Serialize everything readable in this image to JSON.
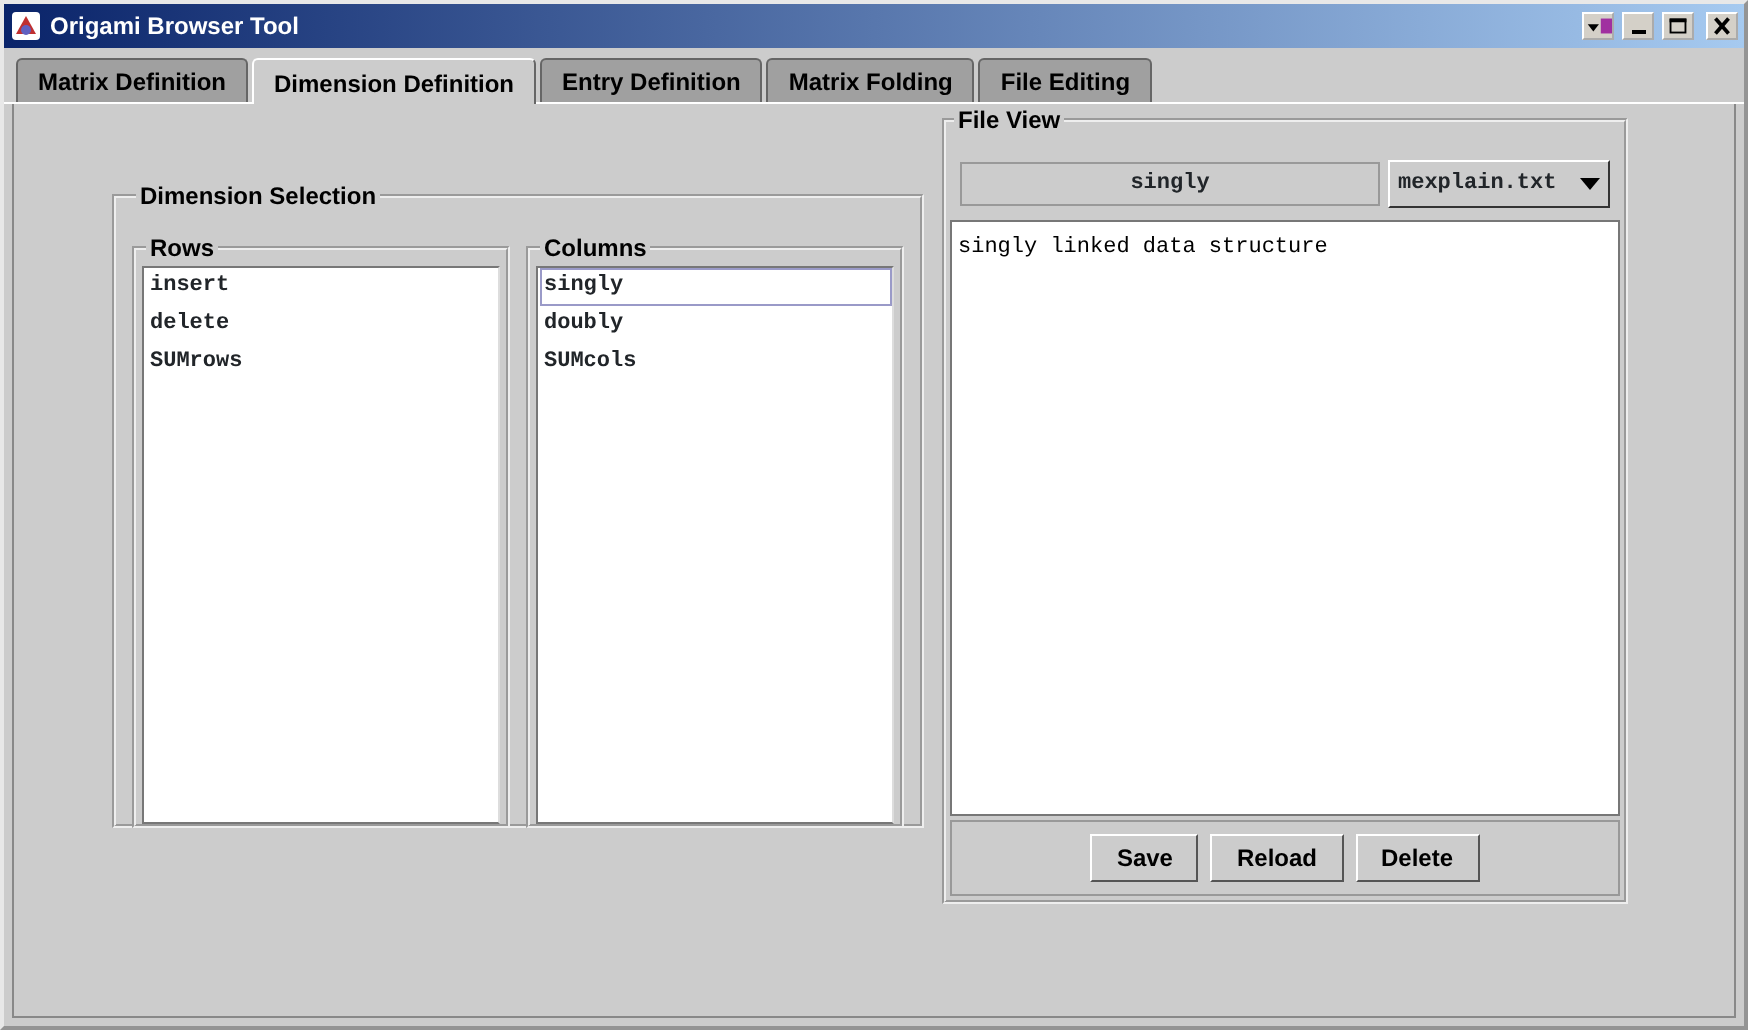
{
  "window": {
    "title": "Origami Browser Tool"
  },
  "tabs": [
    {
      "label": "Matrix Definition",
      "selected": false
    },
    {
      "label": "Dimension Definition",
      "selected": true
    },
    {
      "label": "Entry Definition",
      "selected": false
    },
    {
      "label": "Matrix Folding",
      "selected": false
    },
    {
      "label": "File Editing",
      "selected": false
    }
  ],
  "dimension_selection": {
    "title": "Dimension Selection",
    "lists": [
      {
        "title": "Rows",
        "items": [
          {
            "label": "insert",
            "selected": false
          },
          {
            "label": "delete",
            "selected": false
          },
          {
            "label": "SUMrows",
            "selected": false
          }
        ]
      },
      {
        "title": "Columns",
        "items": [
          {
            "label": "singly",
            "selected": true
          },
          {
            "label": "doubly",
            "selected": false
          },
          {
            "label": "SUMcols",
            "selected": false
          }
        ]
      }
    ]
  },
  "file_view": {
    "title": "File View",
    "dimension": "singly",
    "file": "mexplain.txt",
    "content": "singly linked data structure",
    "buttons": [
      "Save",
      "Reload",
      "Delete"
    ]
  }
}
